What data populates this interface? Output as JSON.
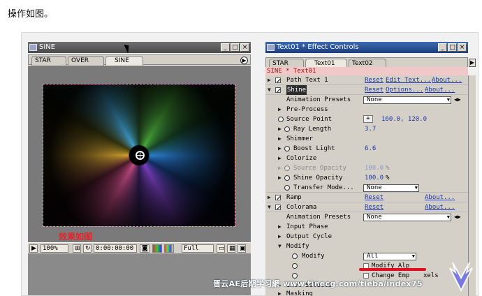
{
  "page": {
    "text": "操作如图。"
  },
  "comp": {
    "title": "SINE",
    "tabs": [
      "STAR",
      "OVER",
      "SINE"
    ],
    "caption": "效果如图",
    "bottom": {
      "zoom": "100%",
      "time": "0:00:00:00",
      "resolution": "Full"
    }
  },
  "effect_controls": {
    "title": "Text01 * Effect Controls",
    "tabs": [
      "STAR",
      "Text01",
      "Text02"
    ],
    "header": "SINE * Text01",
    "rows": {
      "path_text": {
        "label": "Path Text 1",
        "reset": "Reset",
        "edit": "Edit Text...",
        "about": "About..."
      },
      "shine": {
        "label": "Shine",
        "reset": "Reset",
        "options": "Options...",
        "about": "About..."
      },
      "anim_presets_1": {
        "label": "Animation Presets",
        "value": "None"
      },
      "pre_process": {
        "label": "Pre-Process"
      },
      "source_point": {
        "label": "Source Point",
        "value": "160.0, 120.0"
      },
      "ray_length": {
        "label": "Ray Length",
        "value": "3.7"
      },
      "shimmer": {
        "label": "Shimmer"
      },
      "boost_light": {
        "label": "Boost Light",
        "value": "6.6"
      },
      "colorize": {
        "label": "Colorize"
      },
      "source_opacity": {
        "label": "Source Opacity",
        "value": "100.0",
        "unit": "%"
      },
      "shine_opacity": {
        "label": "Shine Opacity",
        "value": "100.0",
        "unit": "%"
      },
      "transfer_mode": {
        "label": "Transfer Mode...",
        "value": "None"
      },
      "ramp": {
        "label": "Ramp",
        "reset": "Reset",
        "about": "About..."
      },
      "colorama": {
        "label": "Colorama",
        "reset": "Reset",
        "about": "About..."
      },
      "anim_presets_2": {
        "label": "Animation Presets",
        "value": "None"
      },
      "input_phase": {
        "label": "Input Phase"
      },
      "output_cycle": {
        "label": "Output Cycle"
      },
      "modify": {
        "label": "Modify"
      },
      "modify_sub": {
        "label": "Modify",
        "value": "All"
      },
      "modify_alpha": {
        "label": "Modify Alp"
      },
      "change_empty": {
        "label": "Change Emp",
        "tail": "xels"
      },
      "pixel_sel": {
        "label": "ixel Selecti"
      },
      "masking": {
        "label": "Masking"
      }
    }
  },
  "watermark": "晋云AE后期学习網 www.tinecg.com/tieba/index75"
}
